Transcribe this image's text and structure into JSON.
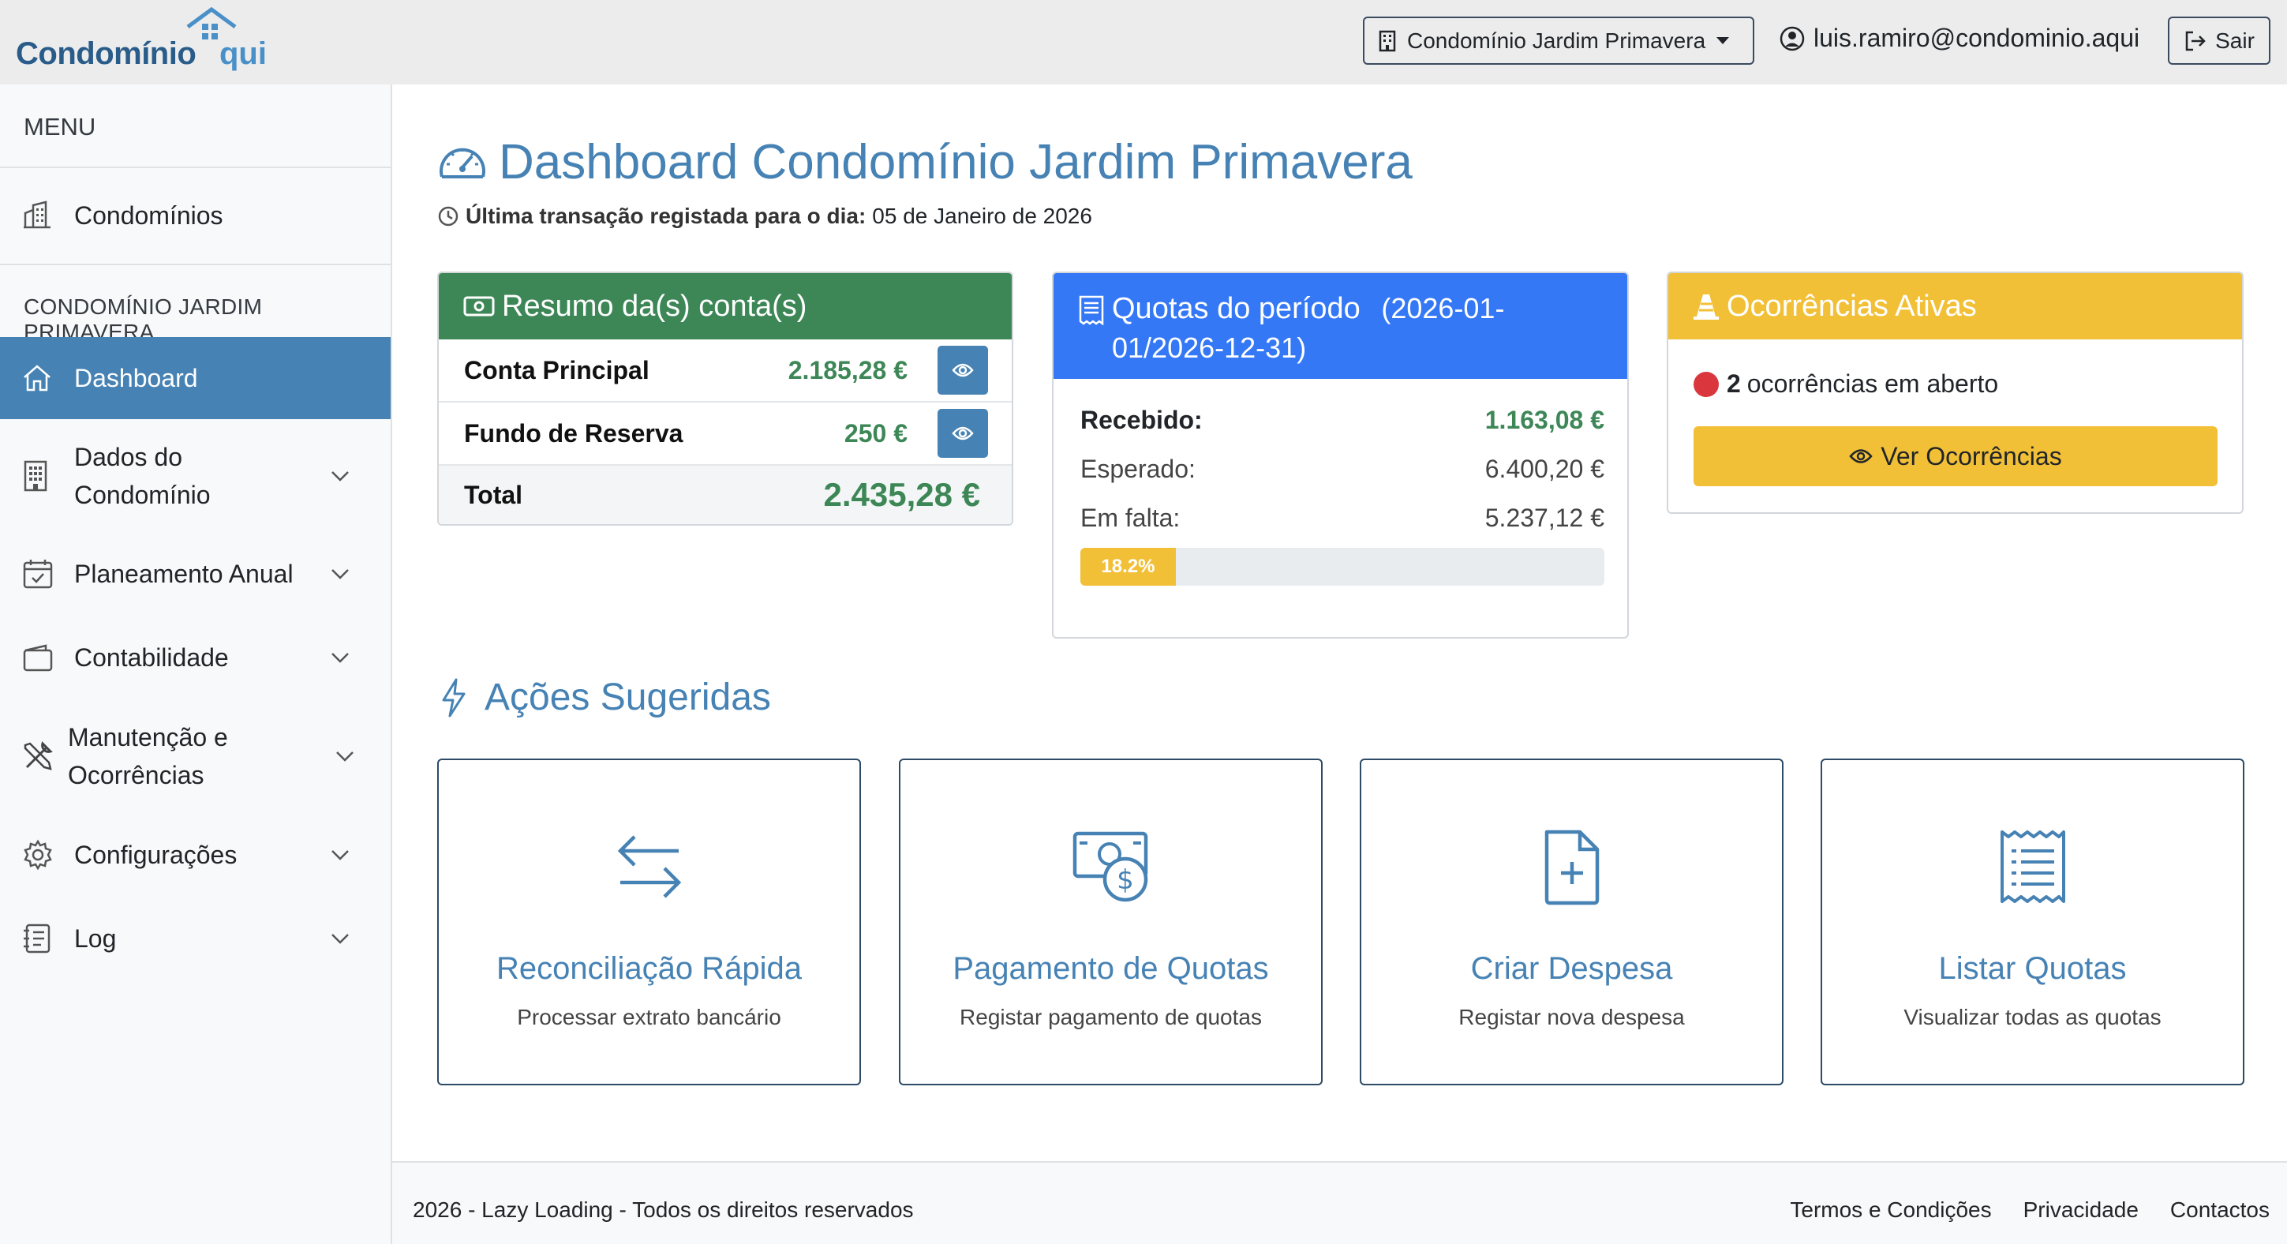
{
  "brand": {
    "name_part1": "Condomínio",
    "name_part2": "qui",
    "color_primary": "#2a5c8a",
    "color_secondary": "#4a90c8"
  },
  "header": {
    "condo_select": "Condomínio Jardim Primavera",
    "user_email": "luis.ramiro@condominio.aqui",
    "logout_label": "Sair"
  },
  "sidebar": {
    "menu_title": "MENU",
    "top_items": [
      {
        "label": "Condomínios",
        "icon": "building-icon"
      }
    ],
    "section_title": "CONDOMÍNIO JARDIM PRIMAVERA",
    "items": [
      {
        "label": "Dashboard",
        "icon": "home-icon",
        "active": true
      },
      {
        "label": "Dados do Condomínio",
        "icon": "building-grid-icon",
        "has_submenu": true
      },
      {
        "label": "Planeamento Anual",
        "icon": "calendar-check-icon",
        "has_submenu": true
      },
      {
        "label": "Contabilidade",
        "icon": "wallet-icon",
        "has_submenu": true
      },
      {
        "label": "Manutenção e Ocorrências",
        "icon": "tools-icon",
        "has_submenu": true
      },
      {
        "label": "Configurações",
        "icon": "gear-icon",
        "has_submenu": true
      },
      {
        "label": "Log",
        "icon": "journal-icon",
        "has_submenu": true
      }
    ]
  },
  "main": {
    "title": "Dashboard Condomínio Jardim Primavera",
    "last_tx_label": "Última transação registada para o dia:",
    "last_tx_date": "05 de Janeiro de 2026",
    "accounts_card": {
      "title": "Resumo da(s) conta(s)",
      "color": "#3d8757",
      "accounts": [
        {
          "name": "Conta Principal",
          "balance": "2.185,28 €"
        },
        {
          "name": "Fundo de Reserva",
          "balance": "250 €"
        }
      ],
      "total_label": "Total",
      "total_value": "2.435,28 €"
    },
    "quotas_card": {
      "title": "Quotas do período",
      "period": "(2026-01-01/2026-12-31)",
      "color": "#3478f6",
      "received_label": "Recebido:",
      "received_value": "1.163,08 €",
      "expected_label": "Esperado:",
      "expected_value": "6.400,20 €",
      "missing_label": "Em falta:",
      "missing_value": "5.237,12 €",
      "progress_label": "18.2%",
      "progress_fraction": 0.182
    },
    "occurrences_card": {
      "title": "Ocorrências Ativas",
      "color": "#f2c037",
      "count": "2",
      "count_text": "ocorrências em aberto",
      "button_label": "Ver Ocorrências"
    },
    "suggested": {
      "title": "Ações Sugeridas",
      "actions": [
        {
          "title": "Reconciliação Rápida",
          "subtitle": "Processar extrato bancário",
          "icon": "arrows-exchange-icon"
        },
        {
          "title": "Pagamento de Quotas",
          "subtitle": "Registar pagamento de quotas",
          "icon": "cash-coin-icon"
        },
        {
          "title": "Criar Despesa",
          "subtitle": "Registar nova despesa",
          "icon": "file-plus-icon"
        },
        {
          "title": "Listar Quotas",
          "subtitle": "Visualizar todas as quotas",
          "icon": "receipt-list-icon"
        }
      ]
    }
  },
  "footer": {
    "copyright": "2026 - Lazy Loading - Todos os direitos reservados",
    "links": [
      "Termos e Condições",
      "Privacidade",
      "Contactos"
    ]
  }
}
